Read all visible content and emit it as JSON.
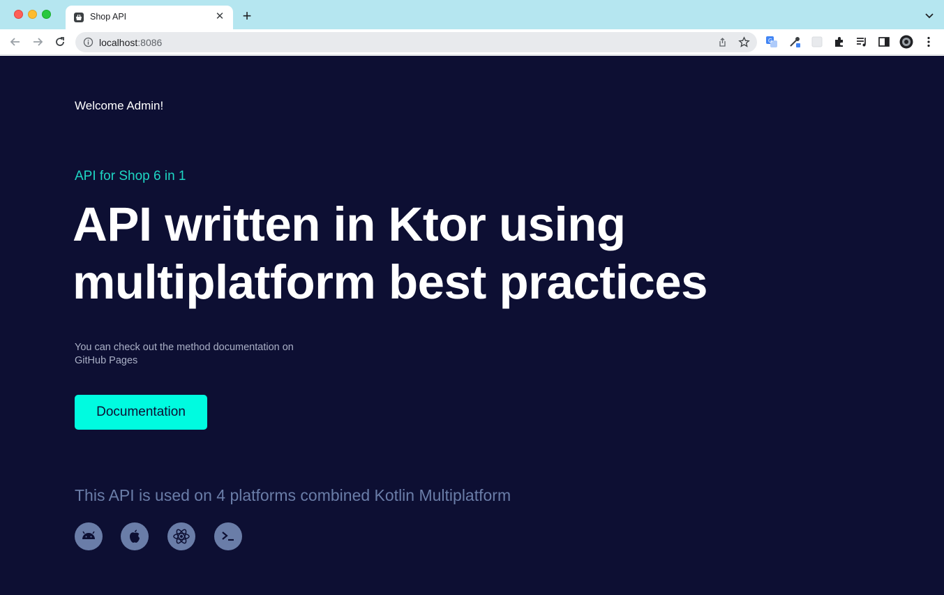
{
  "browser": {
    "tab_title": "Shop API",
    "new_tab_label": "+",
    "close_label": "✕",
    "url_host": "localhost",
    "url_port": ":8086"
  },
  "page": {
    "welcome": "Welcome Admin!",
    "subtitle": "API for Shop 6 in 1",
    "headline_line1": "API written in Ktor using",
    "headline_line2": "multiplatform best practices",
    "description_line1": "You can check out the method documentation on",
    "description_line2": "GitHub Pages",
    "doc_button": "Documentation",
    "platforms_text": "This API is used on 4 platforms combined Kotlin Multiplatform",
    "platform_icons": [
      "android-icon",
      "apple-icon",
      "react-icon",
      "terminal-icon"
    ]
  },
  "colors": {
    "background": "#0d0f33",
    "accent": "#00fbe0",
    "subtitle": "#1ed6c4",
    "muted": "#6a7da8"
  }
}
